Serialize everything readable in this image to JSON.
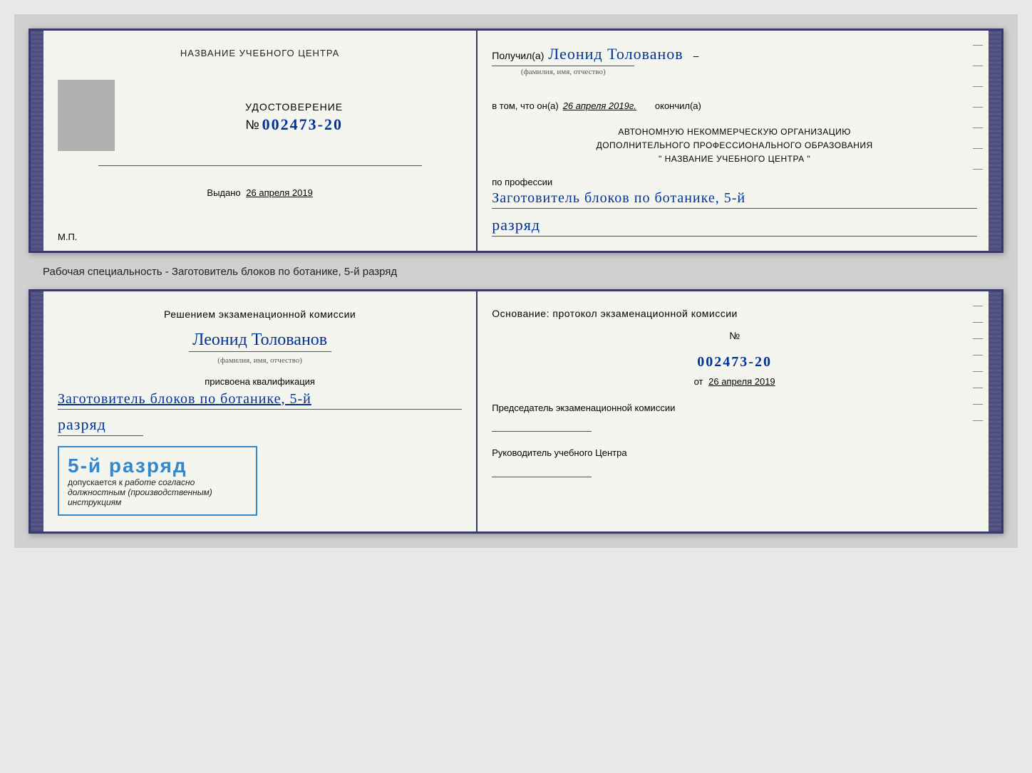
{
  "page": {
    "background": "#d0d0d0"
  },
  "top_certificate": {
    "left": {
      "heading": "НАЗВАНИЕ УЧЕБНОГО ЦЕНТРА",
      "udost_label": "УДОСТОВЕРЕНИЕ",
      "number_prefix": "№",
      "number": "002473-20",
      "vydano_label": "Выдано",
      "vydano_date": "26 апреля 2019",
      "mp_label": "М.П."
    },
    "right": {
      "poluchil_prefix": "Получил(а)",
      "person_name": "Леонид Толованов",
      "fio_label": "(фамилия, имя, отчество)",
      "vtom_prefix": "в том, что он(а)",
      "vtom_date": "26 апреля 2019г.",
      "okoncil_label": "окончил(а)",
      "avt_line1": "АВТОНОМНУЮ НЕКОММЕРЧЕСКУЮ ОРГАНИЗАЦИЮ",
      "avt_line2": "ДОПОЛНИТЕЛЬНОГО ПРОФЕССИОНАЛЬНОГО ОБРАЗОВАНИЯ",
      "avt_line3": "\" НАЗВАНИЕ УЧЕБНОГО ЦЕНТРА \"",
      "po_professii": "по профессии",
      "profession": "Заготовитель блоков по ботанике, 5-й",
      "razryad": "разряд"
    }
  },
  "specialty_label": "Рабочая специальность - Заготовитель блоков по ботанике, 5-й разряд",
  "bottom_certificate": {
    "left": {
      "resheniem_text": "Решением экзаменационной комиссии",
      "person_name": "Леонид Толованов",
      "fio_label": "(фамилия, имя, отчество)",
      "prisvoena_text": "присвоена квалификация",
      "qualification": "Заготовитель блоков по ботанике, 5-й",
      "razryad": "разряд",
      "stamp_grade": "5-й разряд",
      "stamp_dopuskaetsya": "допускается к",
      "stamp_italic": "работе согласно должностным (производственным) инструкциям"
    },
    "right": {
      "osnovanie_text": "Основание: протокол экзаменационной комиссии",
      "number_prefix": "№",
      "number": "002473-20",
      "ot_prefix": "от",
      "ot_date": "26 апреля 2019",
      "predsedatel_label": "Председатель экзаменационной комиссии",
      "rukovoditel_label": "Руководитель учебного Центра"
    }
  }
}
